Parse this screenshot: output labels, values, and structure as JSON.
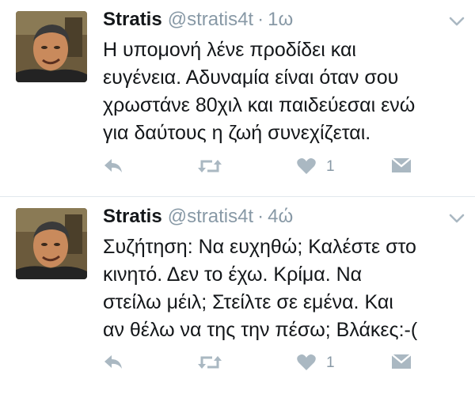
{
  "tweets": [
    {
      "name": "Stratis",
      "handle": "@stratis4t",
      "dot": "·",
      "time": "1ω",
      "lines": [
        "Η υπομονή λένε προδίδει και",
        "ευγένεια. Αδυναμία είναι όταν σου",
        "χρωστάνε 80χιλ και παιδεύεσαι ενώ",
        "για δαύτους η ζωή συνεχίζεται."
      ],
      "likes": "1"
    },
    {
      "name": "Stratis",
      "handle": "@stratis4t",
      "dot": "·",
      "time": "4ώ",
      "lines": [
        "Συζήτηση: Να ευχηθώ; Καλέστε στο",
        "κινητό. Δεν το έχω. Κρίμα. Να",
        "στείλω μέιλ; Στείλτε σε εμένα. Και",
        "αν θέλω να της την πέσω; Βλάκες:-("
      ],
      "likes": "1"
    }
  ],
  "icons": {
    "reply": "reply-icon",
    "retweet": "retweet-icon",
    "like": "heart-icon",
    "message": "direct-message-icon",
    "more": "chevron-down-icon"
  },
  "colors": {
    "text": "#14171a",
    "muted": "#8899a6",
    "icon": "#aab8c2",
    "divider": "#e1e8ed"
  }
}
